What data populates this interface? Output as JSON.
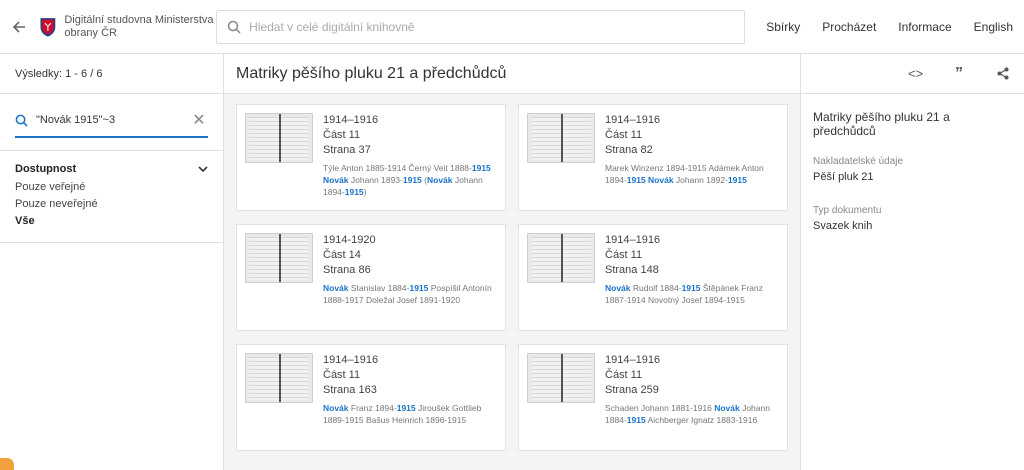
{
  "header": {
    "back_icon": "arrow-left-icon",
    "logo_text": "Digitální studovna Ministerstva obrany ČR",
    "search_placeholder": "Hledat v celé digitální knihovně",
    "nav": [
      "Sbírky",
      "Procházet",
      "Informace",
      "English"
    ]
  },
  "sidebar": {
    "results_label": "Výsledky: 1 - 6",
    "results_total": "/ 6",
    "query": "\"Novák 1915\"~3",
    "facet": {
      "title": "Dostupnost",
      "options": [
        "Pouze veřejné",
        "Pouze neveřejné",
        "Vše"
      ]
    }
  },
  "main": {
    "title": "Matriky pěšího pluku 21 a předchůdců",
    "cards": [
      {
        "years": "1914–1916",
        "part": "Část 11",
        "page": "Strana 37",
        "snippet": [
          [
            "Týle Anton 1885-1914 Černý Veit 1888-",
            false
          ],
          [
            "1915",
            true
          ],
          [
            " ",
            false
          ],
          [
            "Novák",
            true
          ],
          [
            " Johann 1893-",
            false
          ],
          [
            "1915",
            true
          ],
          [
            " (",
            false
          ],
          [
            "Novák",
            true
          ],
          [
            " Johann 1894-",
            false
          ],
          [
            "1915",
            true
          ],
          [
            ")",
            false
          ]
        ]
      },
      {
        "years": "1914–1916",
        "part": "Část 11",
        "page": "Strana 82",
        "snippet": [
          [
            "Marek Winzenz 1894-1915 Adámek Anton 1894-",
            false
          ],
          [
            "1915",
            true
          ],
          [
            " ",
            false
          ],
          [
            "Novák",
            true
          ],
          [
            " Johann 1892-",
            false
          ],
          [
            "1915",
            true
          ]
        ]
      },
      {
        "years": "1914-1920",
        "part": "Část 14",
        "page": "Strana 86",
        "snippet": [
          [
            "Novák",
            true
          ],
          [
            " Stanislav 1884-",
            false
          ],
          [
            "1915",
            true
          ],
          [
            " Pospíšil Antonín 1888-1917 Doležal Josef 1891-1920",
            false
          ]
        ]
      },
      {
        "years": "1914–1916",
        "part": "Část 11",
        "page": "Strana 148",
        "snippet": [
          [
            "Novák",
            true
          ],
          [
            " Rudolf 1884-",
            false
          ],
          [
            "1915",
            true
          ],
          [
            " Štěpánek Franz 1887-1914 Novotný Josef 1894-1915",
            false
          ]
        ]
      },
      {
        "years": "1914–1916",
        "part": "Část 11",
        "page": "Strana 163",
        "snippet": [
          [
            "Novák",
            true
          ],
          [
            " Franz 1894-",
            false
          ],
          [
            "1915",
            true
          ],
          [
            " Jiroušek Gottlieb 1889-1915 Bašus Heinrich 1896-1915",
            false
          ]
        ]
      },
      {
        "years": "1914–1916",
        "part": "Část 11",
        "page": "Strana 259",
        "snippet": [
          [
            "Schaden Johann 1881-1916 ",
            false
          ],
          [
            "Novák",
            true
          ],
          [
            " Johann 1884-",
            false
          ],
          [
            "1915",
            true
          ],
          [
            " Aichberger Ignatz 1883-1916",
            false
          ]
        ]
      }
    ]
  },
  "details": {
    "toolbar": [
      "code-icon",
      "quote-icon",
      "share-icon"
    ],
    "title": "Matriky pěšího pluku 21 a předchůdců",
    "publisher_label": "Nakladatelské údaje",
    "publisher_value": "Pěší pluk 21",
    "type_label": "Typ dokumentu",
    "type_value": "Svazek knih"
  },
  "colors": {
    "accent": "#1a73c8",
    "logo_red": "#c8102e",
    "logo_blue": "#1f3f8f"
  }
}
